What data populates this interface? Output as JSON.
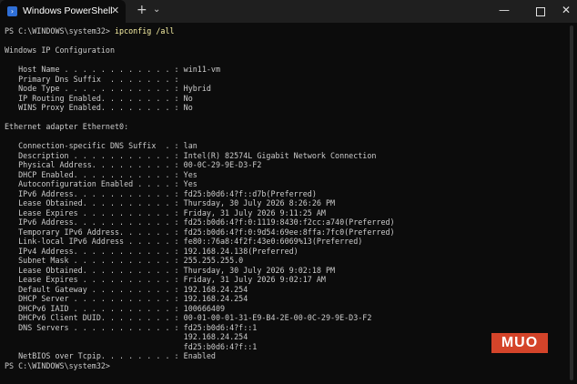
{
  "window": {
    "tab_title": "Windows PowerShell",
    "tab_icon_glyph": "›",
    "close_tab_glyph": "✕",
    "new_tab_glyph": "+",
    "dropdown_glyph": "⌄",
    "minimize_glyph": "—",
    "close_glyph": "✕"
  },
  "console": {
    "prompt": "PS C:\\WINDOWS\\system32> ",
    "command": "ipconfig /all",
    "header": "Windows IP Configuration",
    "global": [
      {
        "label": "   Host Name . . . . . . . . . . . . : ",
        "value": "win11-vm"
      },
      {
        "label": "   Primary Dns Suffix  . . . . . . . : ",
        "value": ""
      },
      {
        "label": "   Node Type . . . . . . . . . . . . : ",
        "value": "Hybrid"
      },
      {
        "label": "   IP Routing Enabled. . . . . . . . : ",
        "value": "No"
      },
      {
        "label": "   WINS Proxy Enabled. . . . . . . . : ",
        "value": "No"
      }
    ],
    "adapter_header": "Ethernet adapter Ethernet0:",
    "adapter": [
      {
        "label": "   Connection-specific DNS Suffix  . : ",
        "value": "lan"
      },
      {
        "label": "   Description . . . . . . . . . . . : ",
        "value": "Intel(R) 82574L Gigabit Network Connection"
      },
      {
        "label": "   Physical Address. . . . . . . . . : ",
        "value": "00-0C-29-9E-D3-F2"
      },
      {
        "label": "   DHCP Enabled. . . . . . . . . . . : ",
        "value": "Yes"
      },
      {
        "label": "   Autoconfiguration Enabled . . . . : ",
        "value": "Yes"
      },
      {
        "label": "   IPv6 Address. . . . . . . . . . . : ",
        "value": "fd25:b0d6:4?f::d7b(Preferred)"
      },
      {
        "label": "   Lease Obtained. . . . . . . . . . : ",
        "value": "Thursday, 30 July 2026 8:26:26 PM"
      },
      {
        "label": "   Lease Expires . . . . . . . . . . : ",
        "value": "Friday, 31 July 2026 9:11:25 AM"
      },
      {
        "label": "   IPv6 Address. . . . . . . . . . . : ",
        "value": "fd25:b0d6:4?f:0:1119:8430:f2cc:a740(Preferred)"
      },
      {
        "label": "   Temporary IPv6 Address. . . . . . : ",
        "value": "fd25:b0d6:4?f:0:9d54:69ee:8ffa:7fc0(Preferred)"
      },
      {
        "label": "   Link-local IPv6 Address . . . . . : ",
        "value": "fe80::76a8:4f2f:43e0:6069%13(Preferred)"
      },
      {
        "label": "   IPv4 Address. . . . . . . . . . . : ",
        "value": "192.168.24.138(Preferred)"
      },
      {
        "label": "   Subnet Mask . . . . . . . . . . . : ",
        "value": "255.255.255.0"
      },
      {
        "label": "   Lease Obtained. . . . . . . . . . : ",
        "value": "Thursday, 30 July 2026 9:02:18 PM"
      },
      {
        "label": "   Lease Expires . . . . . . . . . . : ",
        "value": "Friday, 31 July 2026 9:02:17 AM"
      },
      {
        "label": "   Default Gateway . . . . . . . . . : ",
        "value": "192.168.24.254"
      },
      {
        "label": "   DHCP Server . . . . . . . . . . . : ",
        "value": "192.168.24.254"
      },
      {
        "label": "   DHCPv6 IAID . . . . . . . . . . . : ",
        "value": "100666409"
      },
      {
        "label": "   DHCPv6 Client DUID. . . . . . . . : ",
        "value": "00-01-00-01-31-E9-B4-2E-00-0C-29-9E-D3-F2"
      },
      {
        "label": "   DNS Servers . . . . . . . . . . . : ",
        "value": "fd25:b0d6:4?f::1"
      },
      {
        "label": "                                       ",
        "value": "192.168.24.254"
      },
      {
        "label": "                                       ",
        "value": "fd25:b0d6:4?f::1"
      },
      {
        "label": "   NetBIOS over Tcpip. . . . . . . . : ",
        "value": "Enabled"
      }
    ],
    "final_prompt": "PS C:\\WINDOWS\\system32> "
  },
  "watermark": {
    "text": "MUO",
    "color": "#d4442a"
  },
  "colors": {
    "background": "#0c0c0c",
    "text": "#cccccc",
    "command": "#f9f1a5",
    "titlebar": "#1f1f1f"
  }
}
